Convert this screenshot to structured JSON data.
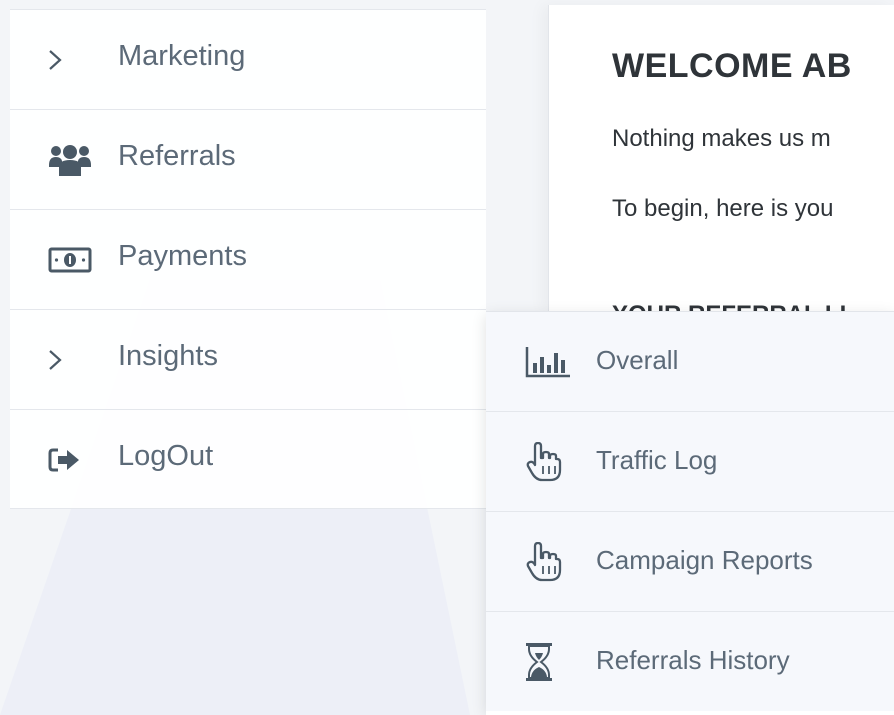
{
  "content": {
    "title": "WELCOME AB",
    "line1": "Nothing makes us m",
    "line2": "To begin, here is you",
    "section_heading": "YOUR REFERRAL LI"
  },
  "sidebar": {
    "items": [
      {
        "label": "Marketing",
        "icon": "chevron-right-icon"
      },
      {
        "label": "Referrals",
        "icon": "users-icon"
      },
      {
        "label": "Payments",
        "icon": "money-bill-icon"
      },
      {
        "label": "Insights",
        "icon": "chevron-right-icon"
      },
      {
        "label": "LogOut",
        "icon": "sign-out-icon"
      }
    ]
  },
  "submenu": {
    "items": [
      {
        "label": "Overall",
        "icon": "bar-chart-icon"
      },
      {
        "label": "Traffic Log",
        "icon": "pointer-hand-icon"
      },
      {
        "label": "Campaign Reports",
        "icon": "pointer-hand-icon"
      },
      {
        "label": "Referrals History",
        "icon": "hourglass-icon"
      }
    ]
  },
  "colors": {
    "icon": "#4a5966",
    "text": "#5c6a78",
    "heading": "#2f3439",
    "background": "#f3f5f8"
  }
}
